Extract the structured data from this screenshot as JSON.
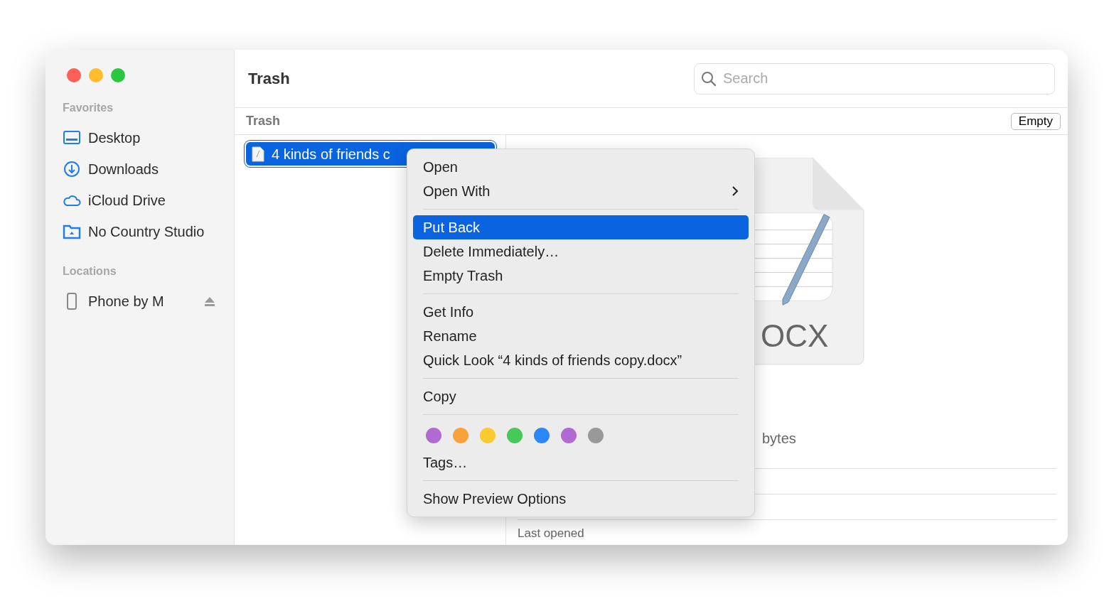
{
  "window": {
    "title": "Trash"
  },
  "search": {
    "placeholder": "Search"
  },
  "sidebar": {
    "sections": [
      {
        "heading": "Favorites",
        "items": [
          {
            "label": "Desktop",
            "ejectable": false
          },
          {
            "label": "Downloads",
            "ejectable": false
          },
          {
            "label": "iCloud Drive",
            "ejectable": false
          },
          {
            "label": "No Country Studio",
            "ejectable": false
          }
        ]
      },
      {
        "heading": "Locations",
        "items": [
          {
            "label": "Phone by M",
            "ejectable": true
          }
        ]
      }
    ]
  },
  "path_bar": {
    "label": "Trash",
    "button": "Empty"
  },
  "files": [
    {
      "name": "4 kinds of friends c",
      "selected": true
    }
  ],
  "preview": {
    "icon_label": "OCX",
    "size": "bytes",
    "rows": [
      {
        "label": "Last opened"
      }
    ]
  },
  "context_menu": {
    "sections": [
      [
        {
          "kind": "command",
          "label": "Open",
          "selected": false
        },
        {
          "kind": "submenu",
          "label": "Open With",
          "selected": false
        }
      ],
      [
        {
          "kind": "command",
          "label": "Put Back",
          "selected": true
        },
        {
          "kind": "command",
          "label": "Delete Immediately…",
          "selected": false
        },
        {
          "kind": "command",
          "label": "Empty Trash",
          "selected": false
        }
      ],
      [
        {
          "kind": "command",
          "label": "Get Info",
          "selected": false
        },
        {
          "kind": "command",
          "label": "Rename",
          "selected": false
        },
        {
          "kind": "command",
          "label": "Quick Look “4 kinds of friends copy.docx”",
          "selected": false
        }
      ],
      [
        {
          "kind": "command",
          "label": "Copy",
          "selected": false
        }
      ],
      [
        {
          "kind": "colors",
          "colors": [
            {
              "color": "#b06ad2"
            },
            {
              "color": "#f7a23b"
            },
            {
              "color": "#f9cb2f"
            },
            {
              "color": "#46c85a"
            },
            {
              "color": "#2c88f6"
            },
            {
              "color": "#b06ad2"
            },
            {
              "color": "#999999"
            }
          ]
        },
        {
          "kind": "command",
          "label": "Tags…",
          "selected": false
        }
      ],
      [
        {
          "kind": "command",
          "label": "Show Preview Options",
          "selected": false
        }
      ]
    ]
  }
}
